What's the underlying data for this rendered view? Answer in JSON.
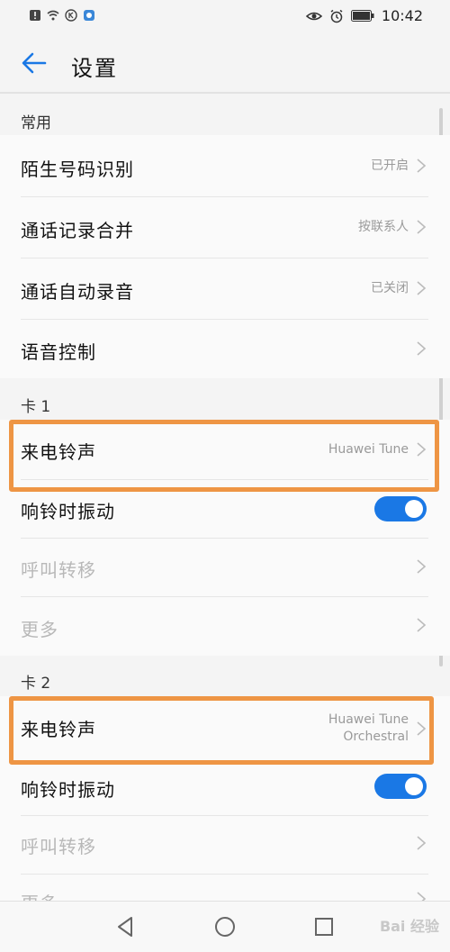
{
  "status_bar": {
    "time": "10:42"
  },
  "app_bar": {
    "title": "设置"
  },
  "sections": {
    "common": {
      "header": "常用",
      "rows": [
        {
          "label": "陌生号码识别",
          "value": "已开启"
        },
        {
          "label": "通话记录合并",
          "value": "按联系人"
        },
        {
          "label": "通话自动录音",
          "value": "已关闭"
        },
        {
          "label": "语音控制",
          "value": ""
        }
      ]
    },
    "card1": {
      "header": "卡 1",
      "ringtone": {
        "label": "来电铃声",
        "value": "Huawei Tune"
      },
      "vibrate": {
        "label": "响铃时振动",
        "on": true
      },
      "forward": {
        "label": "呼叫转移"
      },
      "more": {
        "label": "更多"
      }
    },
    "card2": {
      "header": "卡 2",
      "ringtone": {
        "label": "来电铃声",
        "value_line1": "Huawei Tune",
        "value_line2": "Orchestral"
      },
      "vibrate": {
        "label": "响铃时振动",
        "on": true
      },
      "forward": {
        "label": "呼叫转移"
      },
      "more": {
        "label": "更多"
      }
    }
  },
  "watermark": "Bai 经验",
  "colors": {
    "accent": "#1a78e5",
    "highlight": "#ee9544",
    "back_arrow": "#1a78e5"
  },
  "icons": [
    "back-arrow-icon",
    "chevron-right-icon",
    "nav-back-icon",
    "nav-home-icon",
    "nav-recents-icon"
  ]
}
